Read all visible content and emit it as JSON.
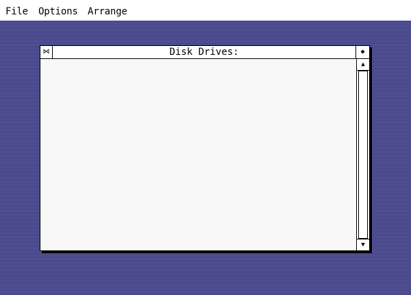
{
  "menubar": {
    "items": [
      {
        "label": "File"
      },
      {
        "label": "Options"
      },
      {
        "label": "Arrange"
      }
    ]
  },
  "window": {
    "title": "Disk Drives:",
    "close_box_glyph": "⋈",
    "fuller_box_glyph": "◆",
    "scroll_up_glyph": "▲",
    "scroll_down_glyph": "▼"
  },
  "colors": {
    "desktop": "#4b4b8f",
    "window_bg": "#ffffff",
    "content_bg": "#f8f8f8"
  }
}
